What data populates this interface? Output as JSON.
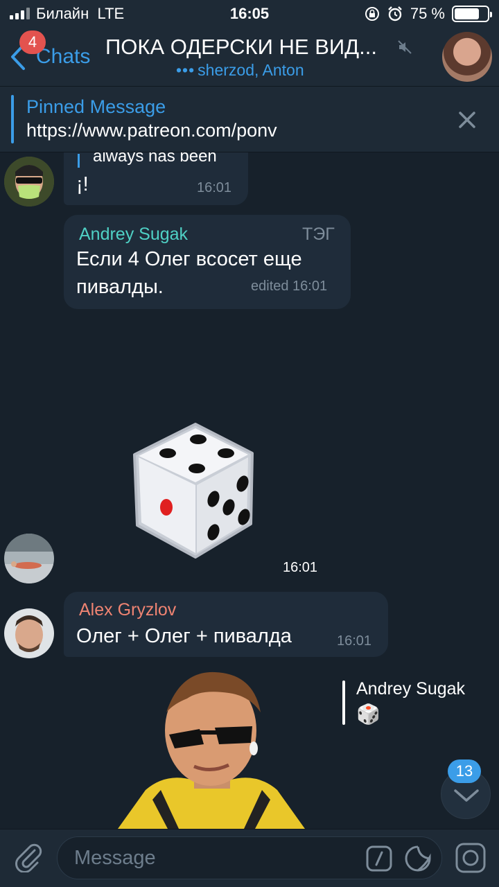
{
  "status_bar": {
    "carrier": "Билайн",
    "network": "LTE",
    "time": "16:05",
    "battery_percent": "75 %",
    "battery_level": 0.75
  },
  "header": {
    "back_label": "Chats",
    "unread_badge": "4",
    "title": "ПОКА ОДЕРСКИ НЕ ВИД...",
    "subtitle_dots": "•••",
    "subtitle": "sherzod, Anton"
  },
  "pinned": {
    "label": "Pinned Message",
    "text": "https://www.patreon.com/ponv"
  },
  "messages": {
    "m1": {
      "quote": "always has been",
      "text": "¡!",
      "time": "16:01"
    },
    "m2": {
      "sender": "Andrey Sugak",
      "tag": "ТЭГ",
      "text1": "Если 4 Олег всосет еще",
      "text2": "пивалды.",
      "time": "edited 16:01"
    },
    "m3": {
      "time": "16:01"
    },
    "m4": {
      "sender": "Alex Gryzlov",
      "text": "Олег + Олег + пивалда",
      "time": "16:01"
    },
    "m5": {
      "reply_name": "Andrey Sugak",
      "reply_glyph": "🎲"
    }
  },
  "scroll": {
    "unread": "13"
  },
  "input": {
    "placeholder": "Message"
  },
  "colors": {
    "background": "#17212b",
    "panel": "#1e2a36",
    "accent": "#3b9de8",
    "badge": "#e3534f",
    "sender_andrey": "#4fd1c5",
    "sender_alex": "#f08472"
  }
}
